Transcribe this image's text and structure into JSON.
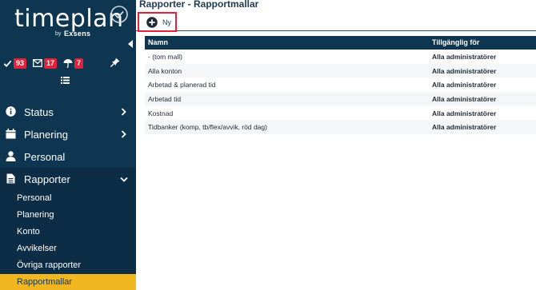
{
  "app": {
    "logo_text": "timeplan",
    "logo_by": "by",
    "logo_brand": "Exsens"
  },
  "counters": [
    {
      "icon": "check-icon",
      "count": "93"
    },
    {
      "icon": "envelope-icon",
      "count": "17"
    },
    {
      "icon": "umbrella-icon",
      "count": "7"
    }
  ],
  "nav": {
    "status": "Status",
    "planering": "Planering",
    "personal": "Personal",
    "rapporter": "Rapporter"
  },
  "sub": {
    "personal": "Personal",
    "planering": "Planering",
    "konto": "Konto",
    "avvikelser": "Avvikelser",
    "ovriga": "Övriga rapporter",
    "rapportmallar": "Rapportmallar"
  },
  "header": {
    "title": "Rapporter - Rapportmallar"
  },
  "toolbar": {
    "new_label": "Ny"
  },
  "table": {
    "columns": [
      "Namn",
      "Tillgänglig för"
    ],
    "rows": [
      [
        "- (tom mall)",
        "Alla administratörer"
      ],
      [
        "Alla konton",
        "Alla administratörer"
      ],
      [
        "Arbetad & planerad tid",
        "Alla administratörer"
      ],
      [
        "Arbetad tid",
        "Alla administratörer"
      ],
      [
        "Kostnad",
        "Alla administratörer"
      ],
      [
        "Tidbanker (komp, tb/flex/avvik, röd dag)",
        "Alla administratörer"
      ]
    ]
  },
  "colors": {
    "sidebar": "#0f3650",
    "accent": "#f2b620",
    "badge": "#e0223a"
  }
}
